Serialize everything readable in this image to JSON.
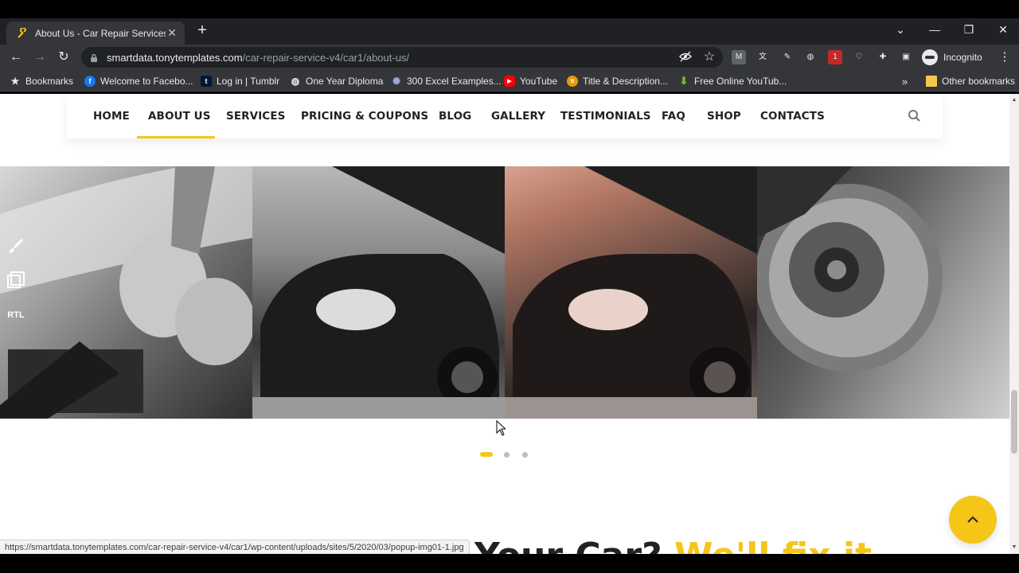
{
  "browser": {
    "tab": {
      "title": "About Us - Car Repair Services",
      "close": "✕"
    },
    "new_tab": "+",
    "window_controls": {
      "dropdown": "⌄",
      "minimize": "—",
      "restore": "❐",
      "close": "✕"
    },
    "nav": {
      "back": "←",
      "forward": "→",
      "reload": "↻"
    },
    "url": {
      "host": "smartdata.tonytemplates.com",
      "path": "/car-repair-service-v4/car1/about-us/"
    },
    "omnibox_icons": [
      "eye-off-icon",
      "star-icon"
    ],
    "extensions": [
      {
        "name": "gmail-extension-icon",
        "label": "M",
        "color": "#5f6368"
      },
      {
        "name": "translate-extension-icon",
        "label": "文",
        "color": "#5f6368"
      },
      {
        "name": "pen-extension-icon",
        "label": "✎",
        "color": "#5f6368"
      },
      {
        "name": "globe-extension-icon",
        "label": "◍",
        "color": "#5f6368"
      },
      {
        "name": "adblock-extension-icon",
        "label": "1",
        "color": "#c62828"
      },
      {
        "name": "shield-extension-icon",
        "label": "♡",
        "color": "#5f6368"
      },
      {
        "name": "puzzle-extensions-icon",
        "label": "✚",
        "color": "#5f6368"
      },
      {
        "name": "sidepanel-icon",
        "label": "▣",
        "color": "#5f6368"
      }
    ],
    "profile": "Incognito",
    "menu": "⋮",
    "bookmarks": [
      {
        "label": "Bookmarks",
        "icon": "star-icon",
        "color": "#e8eaed",
        "glyph": "★"
      },
      {
        "label": "Welcome to Facebo...",
        "icon": "facebook-icon",
        "color": "#1877f2",
        "glyph": "f"
      },
      {
        "label": "Log in | Tumblr",
        "icon": "tumblr-icon",
        "color": "#001935",
        "glyph": "t"
      },
      {
        "label": "One Year Diploma",
        "icon": "globe-icon",
        "color": "#5f6368",
        "glyph": "◍"
      },
      {
        "label": "300 Excel Examples...",
        "icon": "excel-icon",
        "color": "#5b6abf",
        "glyph": "✺"
      },
      {
        "label": "YouTube",
        "icon": "youtube-icon",
        "color": "#ff0000",
        "glyph": "▶"
      },
      {
        "label": "Title & Description...",
        "icon": "tool-icon",
        "color": "#e59a0b",
        "glyph": "tt"
      },
      {
        "label": "Free Online YouTub...",
        "icon": "download-icon",
        "color": "#7cb342",
        "glyph": "⬇"
      }
    ],
    "bookmarks_more": "»",
    "other_bookmarks": "Other bookmarks"
  },
  "site": {
    "nav": [
      "HOME",
      "ABOUT US",
      "SERVICES",
      "PRICING & COUPONS",
      "BLOG",
      "GALLERY",
      "TESTIMONIALS",
      "FAQ",
      "SHOP",
      "CONTACTS"
    ],
    "active_nav": "ABOUT US",
    "side_tools": [
      "brush-icon",
      "layers-icon",
      "RTL"
    ],
    "carousel": {
      "slides": 3,
      "active": 1
    },
    "heading": {
      "dark": "Your Car?",
      "highlight": "We'll fix it"
    },
    "accent_color": "#f5c518"
  },
  "status_bar": "https://smartdata.tonytemplates.com/car-repair-service-v4/car1/wp-content/uploads/sites/5/2020/03/popup-img01-1.jpg"
}
